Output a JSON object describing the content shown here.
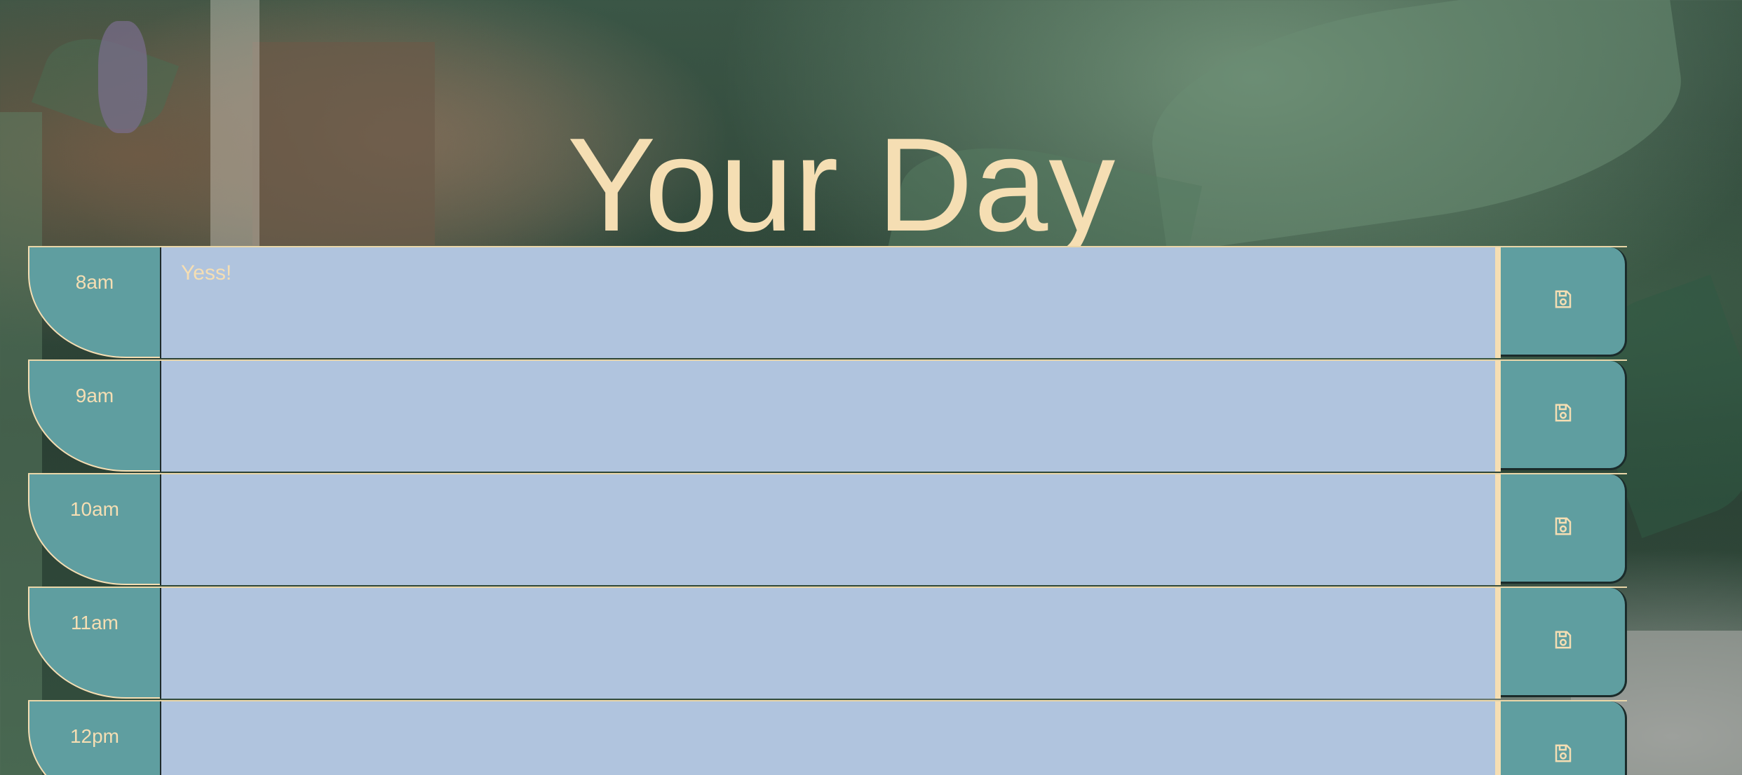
{
  "header": {
    "title": "Your Day"
  },
  "planner": {
    "rows": [
      {
        "hour": "8am",
        "text": "Yess!",
        "save_icon": "save-icon"
      },
      {
        "hour": "9am",
        "text": "",
        "save_icon": "save-icon"
      },
      {
        "hour": "10am",
        "text": "",
        "save_icon": "save-icon"
      },
      {
        "hour": "11am",
        "text": "",
        "save_icon": "save-icon"
      },
      {
        "hour": "12pm",
        "text": "",
        "save_icon": "save-icon"
      }
    ]
  },
  "colors": {
    "title": "#f5deb3",
    "hour_block": "#5f9ea0",
    "entry_block": "#b0c4de",
    "accent": "#f5deb3"
  }
}
